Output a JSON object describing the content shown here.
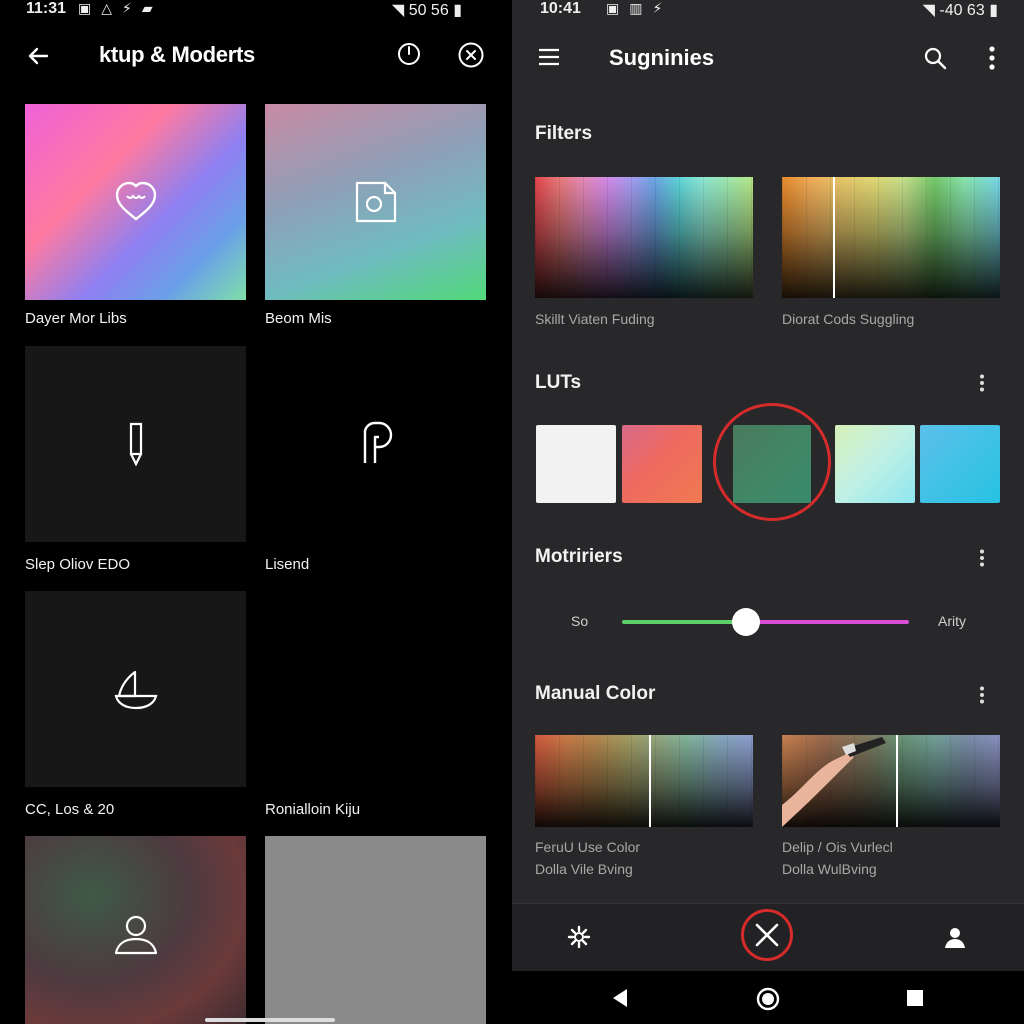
{
  "left_screen": {
    "status": {
      "time": "11:31",
      "right_text": "50  56"
    },
    "title": "ktup & Moderts",
    "tiles": [
      {
        "label": "Dayer Mor Libs",
        "icon": "heart-chat-icon"
      },
      {
        "label": "Beom Mis",
        "icon": "document-icon"
      },
      {
        "label": "Slep Oliov EDO",
        "icon": "marker-icon"
      },
      {
        "label": "Lisend",
        "icon": "p-letter-icon"
      },
      {
        "label": "CC, Los & 20",
        "icon": "sailboat-icon"
      },
      {
        "label": "Ronialloin Kiju",
        "icon": "none"
      },
      {
        "label": "",
        "icon": "user-icon"
      },
      {
        "label": "",
        "icon": "none"
      }
    ]
  },
  "right_screen": {
    "status": {
      "time": "10:41",
      "right_text": "-40  63"
    },
    "title": "Sugninies",
    "filters": {
      "title": "Filters",
      "items": [
        {
          "caption": "Skillt Viaten Fuding"
        },
        {
          "caption": "Diorat Cods Suggling"
        }
      ]
    },
    "luts": {
      "title": "LUTs",
      "swatches": [
        "#f2f2f2",
        "#ee6a5f",
        "#3f8866",
        "#bff0e6",
        "#26c2e2"
      ],
      "selected_index": 2
    },
    "modifiers": {
      "title": "Motririers",
      "left_label": "So",
      "right_label": "Arity",
      "slider_value": 0.43
    },
    "manual_color": {
      "title": "Manual Color",
      "items": [
        {
          "caption_1": "FeruU Use Color",
          "caption_2": "Dolla Vile Bving"
        },
        {
          "caption_1": "Delip / Ois Vurlecl",
          "caption_2": "Dolla WulBving"
        }
      ]
    }
  },
  "colors": {
    "ring": "#d62b2b",
    "slider_left": "#5fd068",
    "slider_right": "#d94ed6"
  }
}
